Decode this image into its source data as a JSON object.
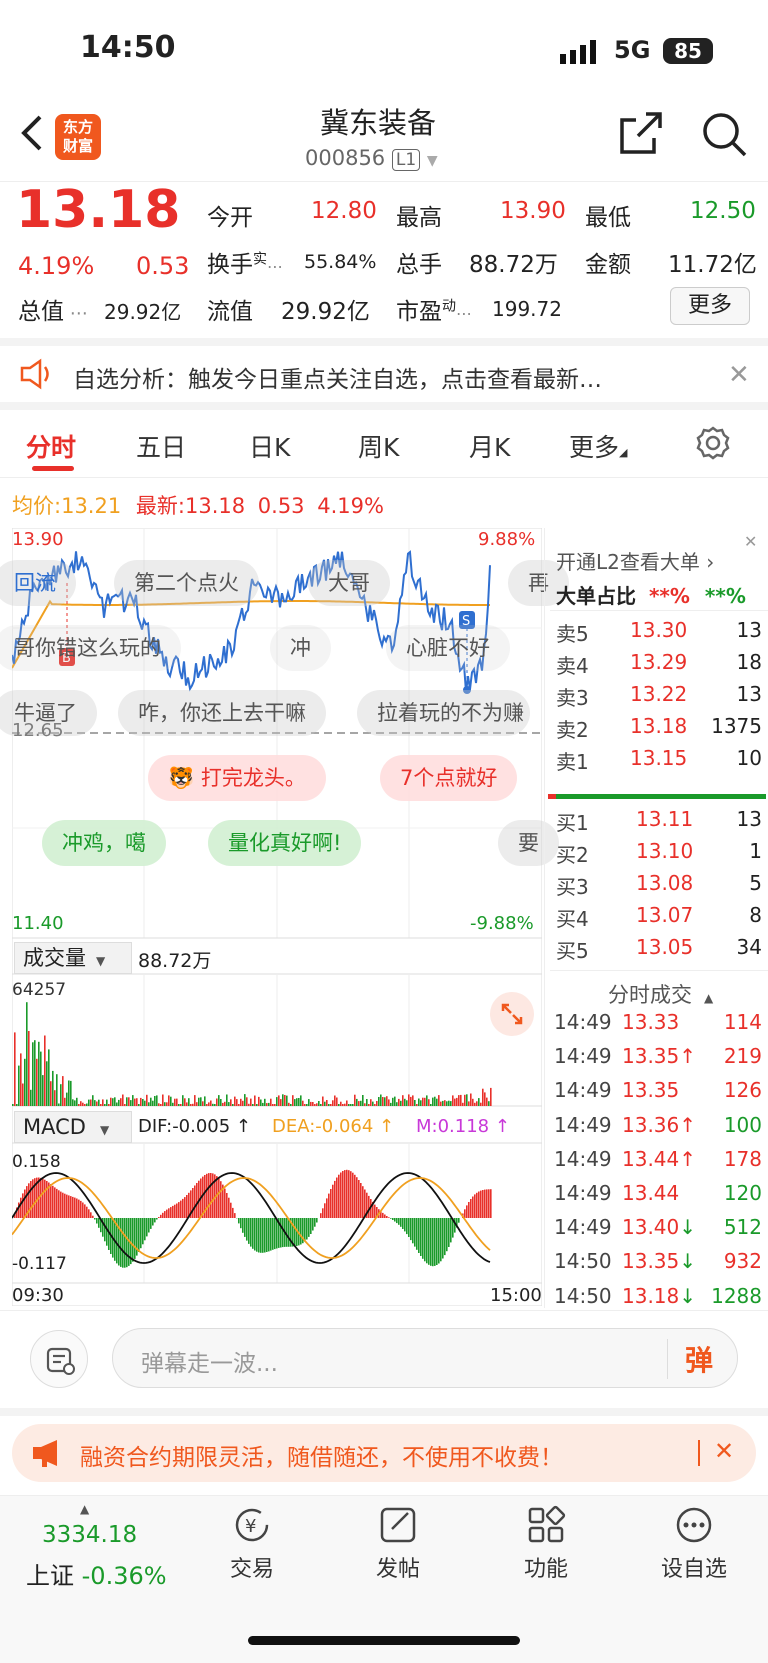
{
  "status": {
    "time": "14:50",
    "network": "5G",
    "battery": "85"
  },
  "header": {
    "title": "冀东装备",
    "code": "000856",
    "level": "L1"
  },
  "quote": {
    "price": "13.18",
    "change_pct": "4.19%",
    "change": "0.53",
    "open_label": "今开",
    "open": "12.80",
    "high_label": "最高",
    "high": "13.90",
    "low_label": "最低",
    "low": "12.50",
    "turnover_label": "换手",
    "turnover_sup": "实",
    "turnover": "55.84%",
    "volume_label": "总手",
    "volume": "88.72万",
    "amount_label": "金额",
    "amount": "11.72亿",
    "mcap_label": "总值",
    "mcap": "29.92亿",
    "float_label": "流值",
    "float": "29.92亿",
    "pe_label": "市盈",
    "pe_sup": "动",
    "pe": "199.72",
    "more": "更多"
  },
  "notice": {
    "text": "自选分析：触发今日重点关注自选，点击查看最新…"
  },
  "tabs": [
    "分时",
    "五日",
    "日K",
    "周K",
    "月K",
    "更多"
  ],
  "chart": {
    "avg_label": "均价:",
    "avg": "13.21",
    "last_label": "最新:",
    "last": "13.18",
    "chg": "0.53",
    "pct": "4.19%",
    "y_high": "13.90",
    "y_prev": "12.65",
    "y_low": "11.40",
    "pct_high": "9.88%",
    "pct_low": "-9.88%",
    "vol_label": "成交量",
    "vol_total": "88.72万",
    "vol_max": "64257",
    "macd_label": "MACD",
    "dif": "DIF:-0.005 ↑",
    "dea": "DEA:-0.064 ↑",
    "m": "M:0.118 ↑",
    "macd_high": "0.158",
    "macd_low": "-0.117",
    "t_start": "09:30",
    "t_end": "15:00"
  },
  "danmaku": [
    {
      "text": "回流",
      "style": "g"
    },
    {
      "text": "第二个点火",
      "style": "g"
    },
    {
      "text": "大哥",
      "style": "g"
    },
    {
      "text": "再",
      "style": "g"
    },
    {
      "text": "哥你错这么玩的",
      "style": "g"
    },
    {
      "text": "冲",
      "style": "g"
    },
    {
      "text": "心脏不好",
      "style": "g"
    },
    {
      "text": "牛逼了",
      "style": "g"
    },
    {
      "text": "咋，你还上去干嘛",
      "style": "g"
    },
    {
      "text": "拉着玩的不为赚",
      "style": "g"
    },
    {
      "text": "打完龙头。",
      "style": "r"
    },
    {
      "text": "7个点就好",
      "style": "r"
    },
    {
      "text": "冲鸡，噶",
      "style": "gr"
    },
    {
      "text": "量化真好啊!",
      "style": "gr"
    },
    {
      "text": "要",
      "style": "g"
    }
  ],
  "orderbook": {
    "title": "开通L2查看大单 ›",
    "big_label": "大单占比",
    "big_red": "**%",
    "big_green": "**%",
    "sells": [
      {
        "label": "卖5",
        "price": "13.30",
        "vol": "13"
      },
      {
        "label": "卖4",
        "price": "13.29",
        "vol": "18"
      },
      {
        "label": "卖3",
        "price": "13.22",
        "vol": "13"
      },
      {
        "label": "卖2",
        "price": "13.18",
        "vol": "1375"
      },
      {
        "label": "卖1",
        "price": "13.15",
        "vol": "10"
      }
    ],
    "buys": [
      {
        "label": "买1",
        "price": "13.11",
        "vol": "13"
      },
      {
        "label": "买2",
        "price": "13.10",
        "vol": "1"
      },
      {
        "label": "买3",
        "price": "13.08",
        "vol": "5"
      },
      {
        "label": "买4",
        "price": "13.07",
        "vol": "8"
      },
      {
        "label": "买5",
        "price": "13.05",
        "vol": "34"
      }
    ]
  },
  "trades": {
    "title": "分时成交",
    "rows": [
      {
        "t": "14:49",
        "p": "13.33",
        "a": "",
        "v": "114",
        "c": "r"
      },
      {
        "t": "14:49",
        "p": "13.35",
        "a": "↑",
        "v": "219",
        "c": "r"
      },
      {
        "t": "14:49",
        "p": "13.35",
        "a": "",
        "v": "126",
        "c": "r"
      },
      {
        "t": "14:49",
        "p": "13.36",
        "a": "↑",
        "v": "100",
        "c": "g"
      },
      {
        "t": "14:49",
        "p": "13.44",
        "a": "↑",
        "v": "178",
        "c": "r"
      },
      {
        "t": "14:49",
        "p": "13.44",
        "a": "",
        "v": "120",
        "c": "g"
      },
      {
        "t": "14:49",
        "p": "13.40",
        "a": "↓",
        "v": "512",
        "c": "g"
      },
      {
        "t": "14:50",
        "p": "13.35",
        "a": "↓",
        "v": "932",
        "c": "r"
      },
      {
        "t": "14:50",
        "p": "13.18",
        "a": "↓",
        "v": "1288",
        "c": "g"
      }
    ]
  },
  "input": {
    "placeholder": "弹幕走一波...",
    "send": "弹"
  },
  "ad": {
    "text": "融资合约期限灵活，随借随还，不使用不收费！"
  },
  "bottom": {
    "index_value": "3334.18",
    "index_name": "上证",
    "index_change": "-0.36%",
    "trade": "交易",
    "post": "发帖",
    "func": "功能",
    "watch": "设自选"
  },
  "colors": {
    "up": "#e8302a",
    "down": "#1a9a2a",
    "accent": "#f0581e",
    "avg_line": "#f0a020",
    "price_line": "#2f6fd0"
  }
}
